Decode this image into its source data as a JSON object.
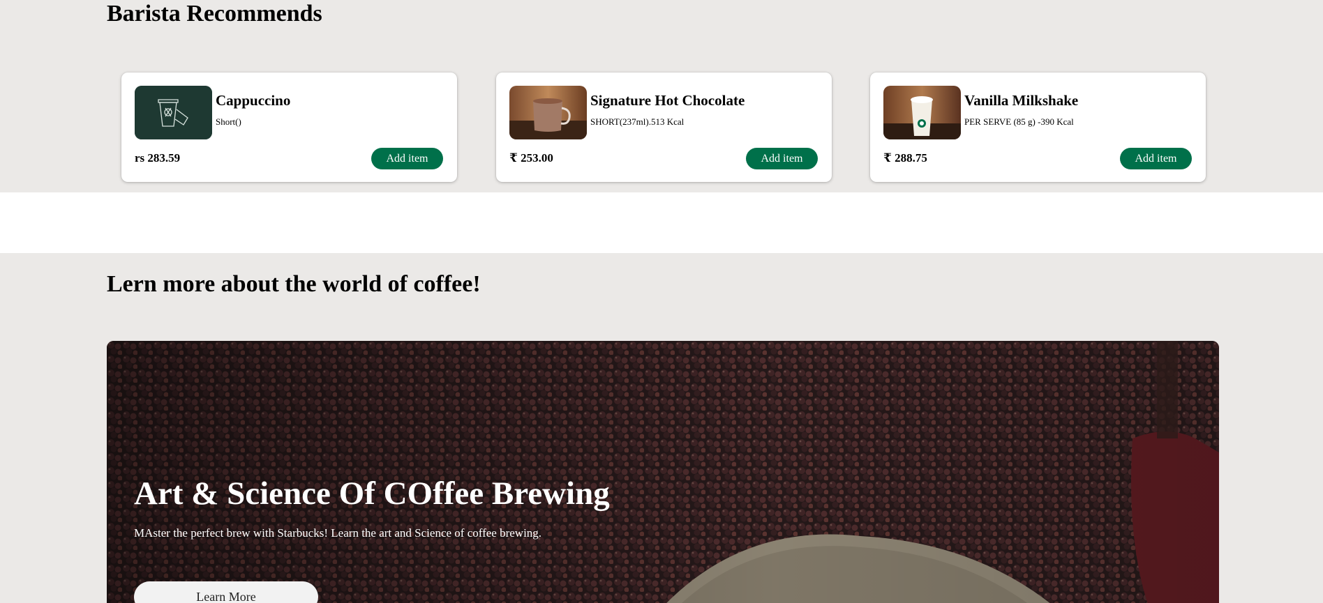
{
  "barista": {
    "heading": "Barista Recommends",
    "items": [
      {
        "name": "Cappuccino",
        "desc": "Short()",
        "price": "rs 283.59",
        "button": "Add item",
        "image": "cup-sketch-icon"
      },
      {
        "name": "Signature Hot Chocolate",
        "desc": "SHORT(237ml).513 Kcal",
        "price": "₹ 253.00",
        "button": "Add item",
        "image": "hot-chocolate-mug-photo"
      },
      {
        "name": "Vanilla Milkshake",
        "desc": "PER SERVE (85 g) -390 Kcal",
        "price": "₹ 288.75",
        "button": "Add item",
        "image": "milkshake-cup-photo"
      }
    ]
  },
  "learn": {
    "heading": "Lern more about the world of coffee!",
    "hero": {
      "title": "Art & Science Of COffee Brewing",
      "text": "MAster the perfect brew with Starbucks! Learn the art and Science of coffee brewing.",
      "button": "Learn More",
      "image": "coffee-beans-photo"
    }
  },
  "colors": {
    "accent": "#00704a",
    "page_bg": "#ebe9e7",
    "card_bg": "#ffffff"
  }
}
